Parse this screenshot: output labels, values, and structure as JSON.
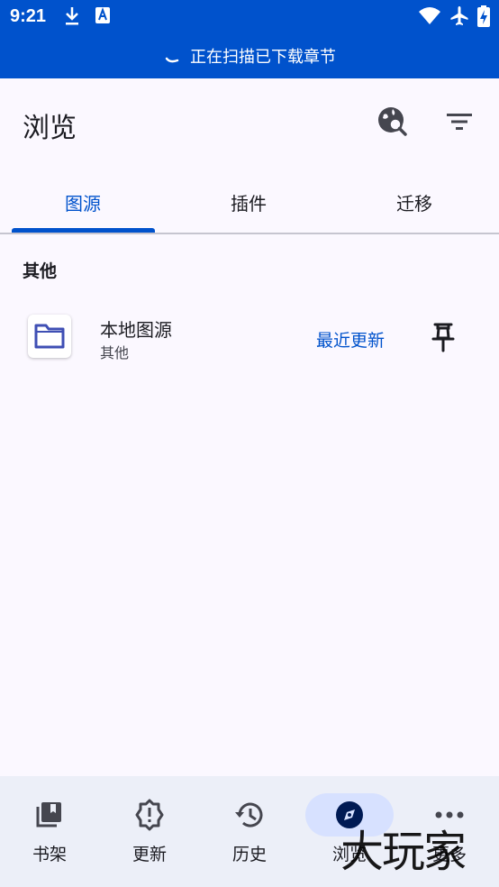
{
  "status_bar": {
    "time": "9:21"
  },
  "banner": {
    "text": "正在扫描已下载章节"
  },
  "appbar": {
    "title": "浏览"
  },
  "tabs": [
    {
      "label": "图源",
      "active": true
    },
    {
      "label": "插件",
      "active": false
    },
    {
      "label": "迁移",
      "active": false
    }
  ],
  "section": {
    "header": "其他"
  },
  "source": {
    "name": "本地图源",
    "language": "其他",
    "latest_label": "最近更新"
  },
  "bottom_nav": [
    {
      "label": "书架",
      "icon": "library-icon"
    },
    {
      "label": "更新",
      "icon": "updates-alert-icon"
    },
    {
      "label": "历史",
      "icon": "history-icon"
    },
    {
      "label": "浏览",
      "icon": "compass-icon",
      "active": true
    },
    {
      "label": "更多",
      "icon": "more-icon"
    }
  ],
  "watermark": "大玩家",
  "colors": {
    "accent": "#0052cc",
    "background": "#fbf8ff",
    "nav_bg": "#eceff8",
    "active_pill": "#d7e1ff"
  }
}
